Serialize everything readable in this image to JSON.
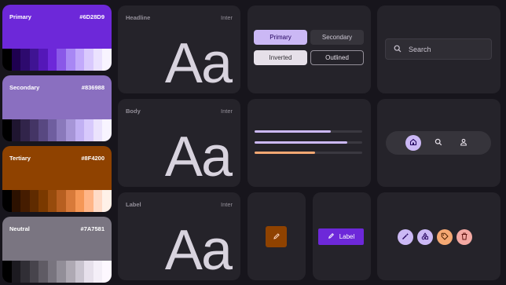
{
  "palettes": [
    {
      "name": "Primary",
      "hex": "#6D28D9",
      "color": "#6d28d9",
      "tones": [
        "#000000",
        "#1e0050",
        "#2d0a6e",
        "#3f1493",
        "#5417b8",
        "#6d28d9",
        "#8a58e8",
        "#a887f4",
        "#c2a9fb",
        "#d9c9fd",
        "#ebe2fe",
        "#f8f4ff"
      ]
    },
    {
      "name": "Secondary",
      "hex": "#836988",
      "color": "#8a6fc0",
      "tones": [
        "#000000",
        "#1f1530",
        "#31244a",
        "#443565",
        "#584881",
        "#6f5e9f",
        "#8a79bb",
        "#a695d7",
        "#c1b0f3",
        "#d7c9fc",
        "#ebe3fd",
        "#f8f4ff"
      ]
    },
    {
      "name": "Tertiary",
      "hex": "#8F4200",
      "color": "#8f4200",
      "tones": [
        "#000000",
        "#2c1100",
        "#451c00",
        "#5f2b00",
        "#7a3900",
        "#974b0c",
        "#b75f20",
        "#d87a3a",
        "#f59756",
        "#ffb587",
        "#ffdbc7",
        "#fff1e8"
      ]
    },
    {
      "name": "Neutral",
      "hex": "#7A7581",
      "color": "#7a7581",
      "tones": [
        "#000000",
        "#1c1a20",
        "#302e35",
        "#47444c",
        "#5f5b64",
        "#78747e",
        "#928e98",
        "#aea9b3",
        "#c9c4cf",
        "#e6e0eb",
        "#f4eff8",
        "#fdf8ff"
      ]
    }
  ],
  "typography": [
    {
      "role": "Headline",
      "font": "Inter",
      "sample": "Aa"
    },
    {
      "role": "Body",
      "font": "Inter",
      "sample": "Aa"
    },
    {
      "role": "Label",
      "font": "Inter",
      "sample": "Aa"
    }
  ],
  "buttons": {
    "primary": "Primary",
    "secondary": "Secondary",
    "inverted": "Inverted",
    "outlined": "Outlined"
  },
  "search": {
    "placeholder": "Search"
  },
  "progress": [
    {
      "value": 0.71,
      "color": "#cbb8f5"
    },
    {
      "value": 0.86,
      "color": "#cbb8f5"
    },
    {
      "value": 0.56,
      "color": "#f5a873"
    }
  ],
  "navbar": {
    "items": [
      "home-icon",
      "search-icon",
      "person-icon"
    ],
    "active": 0
  },
  "label_button": {
    "text": "Label"
  },
  "chips": [
    {
      "icon": "magic-wand-icon",
      "color": "#cbb8f5"
    },
    {
      "icon": "shapes-icon",
      "color": "#cbb8f5"
    },
    {
      "icon": "tag-icon",
      "color": "#f5a873"
    },
    {
      "icon": "trash-icon",
      "color": "#f4a9a3"
    }
  ]
}
